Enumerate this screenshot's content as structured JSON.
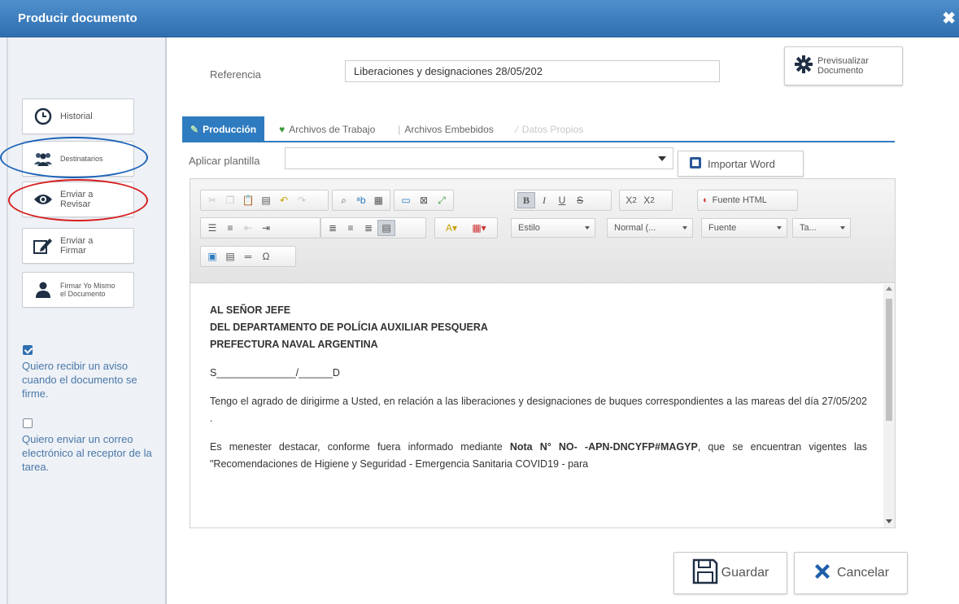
{
  "window": {
    "title": "Producir documento",
    "close_label": "✖"
  },
  "sidebar": {
    "items": [
      {
        "label": "Historial",
        "icon": "clock-icon"
      },
      {
        "label": "Destinatarios",
        "icon": "users-icon"
      },
      {
        "label_line1": "Enviar a",
        "label_line2": "Revisar",
        "icon": "eye-icon"
      },
      {
        "label_line1": "Enviar a",
        "label_line2": "Firmar",
        "icon": "pen-sign-icon"
      },
      {
        "label_line1": "Firmar Yo Mismo",
        "label_line2": "el Documento",
        "icon": "user-icon"
      }
    ],
    "options": [
      {
        "checked": true,
        "label": "Quiero recibir un aviso cuando el documento se firme."
      },
      {
        "checked": false,
        "label": "Quiero enviar un correo electrónico al receptor de la tarea."
      }
    ]
  },
  "header": {
    "referencia_label": "Referencia",
    "referencia_value": "Liberaciones y designaciones 28/05/202",
    "preview_line1": "Previsualizar",
    "preview_line2": "Documento"
  },
  "tabs": [
    {
      "label": "Producción",
      "active": true
    },
    {
      "label": "Archivos de Trabajo",
      "active": false
    },
    {
      "label": "Archivos Embebidos",
      "active": false
    },
    {
      "label": "Datos Propios",
      "active": false,
      "disabled": true
    }
  ],
  "plantilla": {
    "label": "Aplicar plantilla",
    "value": ""
  },
  "import_word_label": "Importar Word",
  "editor_toolbar": {
    "fuente_html_label": "Fuente HTML",
    "estilo_label": "Estilo",
    "formato_label": "Normal (...",
    "fuente_label": "Fuente",
    "tamano_label": "Ta..."
  },
  "document": {
    "heading1": "AL SEÑOR JEFE",
    "heading2": "DEL DEPARTAMENTO DE POLÍCIA AUXILIAR PESQUERA",
    "heading3": "PREFECTURA NAVAL ARGENTINA",
    "ref_line": "S______________/______D",
    "para1": "Tengo el agrado de dirigirme a Usted, en relación a las liberaciones y designaciones de buques correspondientes a las mareas del día 27/05/202 .",
    "para2_start": "Es menester destacar, conforme fuera informado mediante ",
    "para2_bold": "Nota N° NO-",
    "para2_bold2": "-APN-DNCYFP#MAGYP",
    "para2_end": ", que se encuentran vigentes las \"Recomendaciones de Higiene y Seguridad - Emergencia Sanitaria COVID19 - para"
  },
  "actions": {
    "save_label": "Guardar",
    "cancel_label": "Cancelar"
  },
  "colors": {
    "titlebar": "#2f6fb0",
    "tab_active": "#2f7bbf",
    "annotation_blue": "#1a62b8",
    "annotation_red": "#d62020",
    "cancel_x": "#1d5ea8"
  }
}
